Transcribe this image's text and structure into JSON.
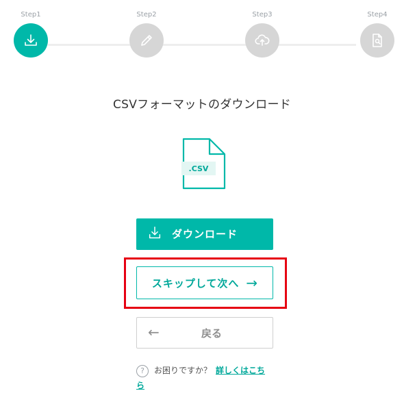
{
  "steps": [
    {
      "label": "Step1",
      "icon": "download-icon",
      "active": true
    },
    {
      "label": "Step2",
      "icon": "pencil-icon",
      "active": false
    },
    {
      "label": "Step3",
      "icon": "cloud-upload-icon",
      "active": false
    },
    {
      "label": "Step4",
      "icon": "document-search-icon",
      "active": false
    }
  ],
  "heading": "CSVフォーマットのダウンロード",
  "file_icon": {
    "tag": ".CSV"
  },
  "buttons": {
    "download_label": "ダウンロード",
    "skip_label": "スキップして次へ",
    "skip_arrow": "→",
    "back_label": "戻る",
    "back_arrow": "←"
  },
  "help": {
    "icon": "?",
    "question": "お困りですか？",
    "link": "詳しくはこちら"
  },
  "colors": {
    "accent": "#00b8a9",
    "inactive": "#d6d6d6",
    "highlight": "#e60012"
  }
}
